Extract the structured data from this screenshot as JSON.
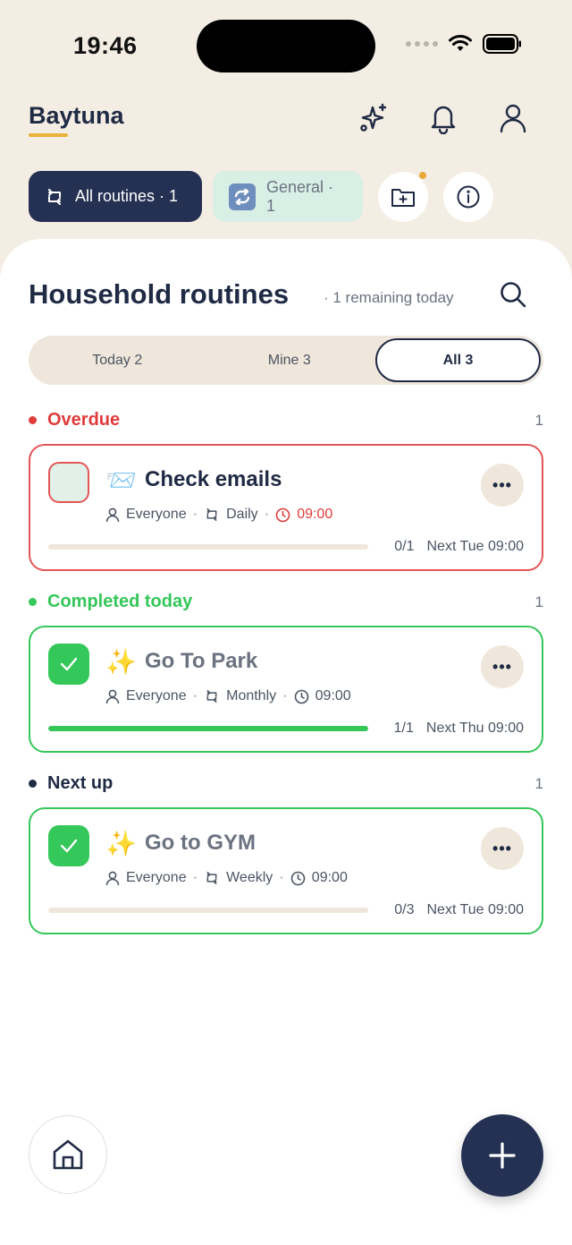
{
  "status_bar": {
    "time": "19:46"
  },
  "header": {
    "brand": "Baytuna"
  },
  "chips": {
    "all_routines": "All routines · 1",
    "general": "General · 1"
  },
  "main": {
    "title": "Household routines",
    "subtitle": "· 1 remaining today",
    "tabs": [
      {
        "label": "Today 2"
      },
      {
        "label": "Mine 3"
      },
      {
        "label": "All 3"
      }
    ],
    "active_tab": "All 3"
  },
  "sections": [
    {
      "label": "Overdue",
      "count": "1",
      "color": "#e03b3b",
      "card": {
        "emoji": "📨",
        "name": "Check emails",
        "assignee": "Everyone",
        "frequency": "Daily",
        "time": "09:00",
        "progress_text": "0/1",
        "progress": 0,
        "next": "Next Tue 09:00",
        "completed": false,
        "border": "#e25656",
        "name_color": "#1f2a44",
        "time_color": "#e03b3b"
      }
    },
    {
      "label": "Completed today",
      "count": "1",
      "color": "#34c759",
      "card": {
        "emoji": "✨",
        "name": "Go To Park",
        "assignee": "Everyone",
        "frequency": "Monthly",
        "time": "09:00",
        "progress_text": "1/1",
        "progress": 1,
        "next": "Next Thu 09:00",
        "completed": true,
        "border": "#34c759",
        "name_color": "#6b7280",
        "time_color": "#4b5563"
      }
    },
    {
      "label": "Next up",
      "count": "1",
      "color": "#1f2a44",
      "card": {
        "emoji": "✨",
        "name": "Go to GYM",
        "assignee": "Everyone",
        "frequency": "Weekly",
        "time": "09:00",
        "progress_text": "0/3",
        "progress": 0,
        "next": "Next Tue 09:00",
        "completed": true,
        "border": "#34c759",
        "name_color": "#6b7280",
        "time_color": "#4b5563"
      }
    }
  ]
}
